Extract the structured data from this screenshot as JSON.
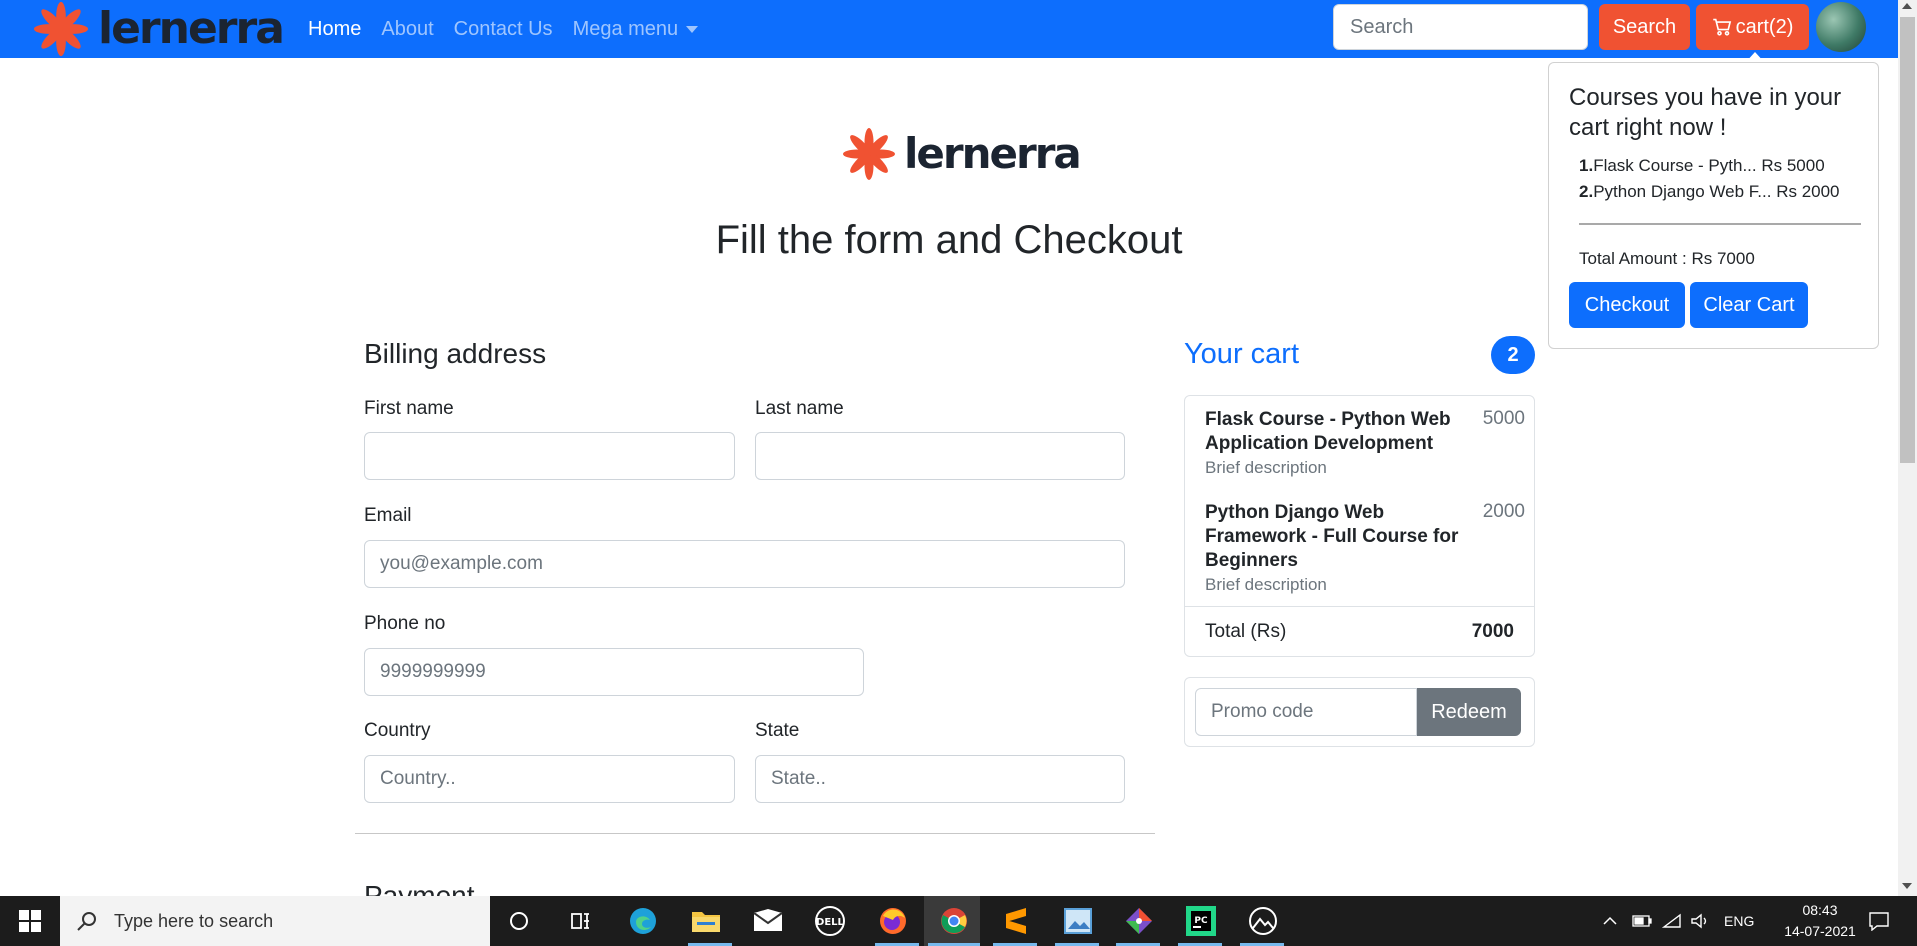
{
  "navbar": {
    "brand": "lernerra",
    "links": [
      {
        "label": "Home",
        "active": true
      },
      {
        "label": "About",
        "active": false
      },
      {
        "label": "Contact Us",
        "active": false
      },
      {
        "label": "Mega menu",
        "active": false
      }
    ],
    "search_placeholder": "Search",
    "search_button": "Search",
    "cart_button": "cart(2)"
  },
  "popover": {
    "title": "Courses you have in your cart right now !",
    "items": [
      {
        "index": "1.",
        "text": "Flask Course - Pyth... Rs 5000"
      },
      {
        "index": "2.",
        "text": "Python Django Web F... Rs 2000"
      }
    ],
    "total": "Total Amount : Rs 7000",
    "checkout_button": "Checkout",
    "clear_button": "Clear Cart"
  },
  "page": {
    "brand": "lernerra",
    "title": "Fill the form and Checkout"
  },
  "billing": {
    "heading": "Billing address",
    "first_name_label": "First name",
    "first_name_value": "",
    "last_name_label": "Last name",
    "last_name_value": "",
    "email_label": "Email",
    "email_placeholder": "you@example.com",
    "phone_label": "Phone no",
    "phone_placeholder": "9999999999",
    "country_label": "Country",
    "country_placeholder": "Country..",
    "state_label": "State",
    "state_placeholder": "State..",
    "next_heading": "Payment"
  },
  "cart": {
    "heading": "Your cart",
    "count": "2",
    "items": [
      {
        "name": "Flask Course - Python Web Application Development",
        "desc": "Brief description",
        "price": "5000"
      },
      {
        "name": "Python Django Web Framework - Full Course for Beginners",
        "desc": "Brief description",
        "price": "2000"
      }
    ],
    "total_label": "Total (Rs)",
    "total_value": "7000",
    "promo_placeholder": "Promo code",
    "redeem_button": "Redeem"
  },
  "taskbar": {
    "search_placeholder": "Type here to search",
    "language": "ENG",
    "time": "08:43",
    "date": "14-07-2021"
  },
  "colors": {
    "primary": "#0d6efd",
    "accent": "#f05232",
    "secondary": "#6c757d"
  }
}
